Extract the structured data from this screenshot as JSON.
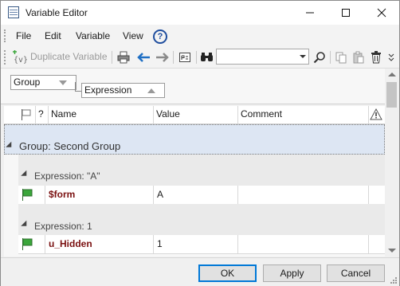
{
  "window": {
    "title": "Variable Editor"
  },
  "menu": {
    "items": [
      "File",
      "Edit",
      "Variable",
      "View"
    ]
  },
  "toolbar": {
    "new_label": "{v}",
    "duplicate_label": "Duplicate Variable",
    "search_value": "",
    "accent": "#1f6fc4"
  },
  "grouping": {
    "group_chip": "Group",
    "expression_chip": "Expression"
  },
  "columns": {
    "name": "Name",
    "value": "Value",
    "comment": "Comment",
    "question": "?"
  },
  "grid": {
    "group_label": "Group: Second Group",
    "subgroups": [
      {
        "label": "Expression: \"A\"",
        "rows": [
          {
            "name": "$form",
            "value": "A",
            "comment": ""
          }
        ]
      },
      {
        "label": "Expression: 1",
        "rows": [
          {
            "name": "u_Hidden",
            "value": "1",
            "comment": ""
          }
        ]
      }
    ]
  },
  "buttons": {
    "ok": "OK",
    "apply": "Apply",
    "cancel": "Cancel"
  },
  "colors": {
    "name_text": "#7a1010",
    "flag_green": "#3aa63a",
    "group_bg": "#dde6f3"
  }
}
